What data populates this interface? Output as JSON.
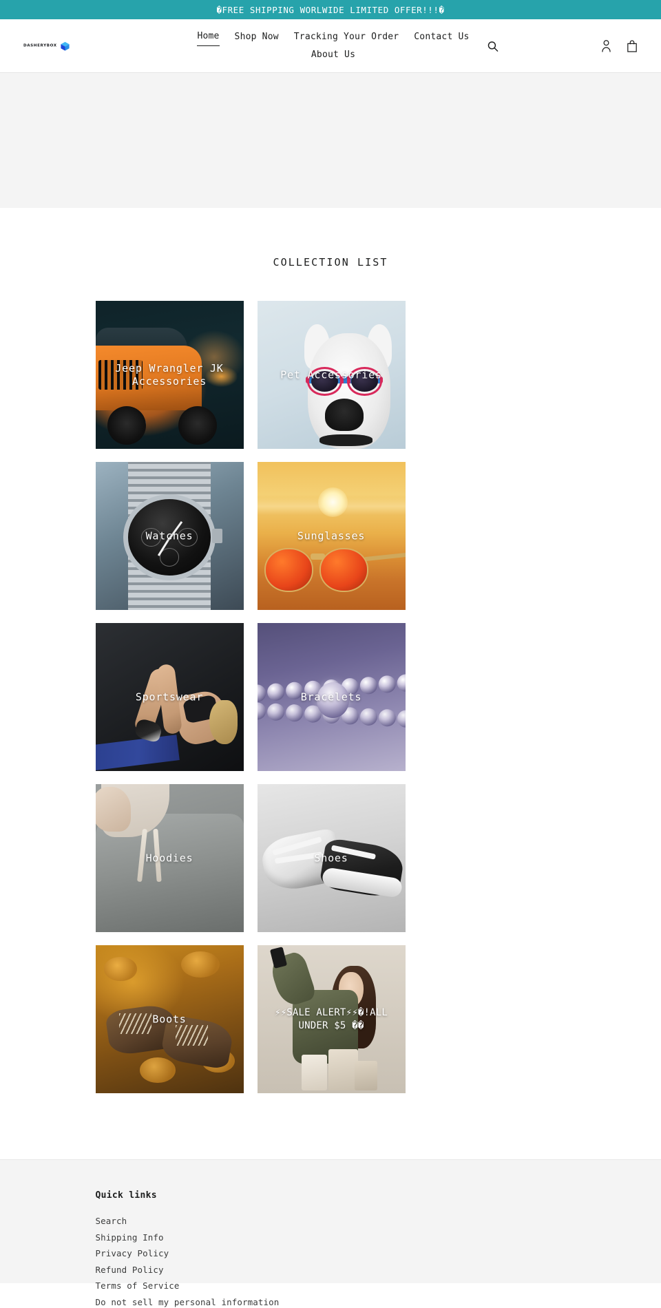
{
  "announcement": {
    "text": "�FREE SHIPPING WORLWIDE LIMITED OFFER!!!�",
    "background": "#27a3ab"
  },
  "header": {
    "logo_text": "DASHERYBOX",
    "nav": [
      {
        "label": "Home",
        "active": true
      },
      {
        "label": "Shop Now",
        "active": false
      },
      {
        "label": "Tracking Your Order",
        "active": false
      },
      {
        "label": "Contact Us",
        "active": false
      },
      {
        "label": "About Us",
        "active": false
      }
    ],
    "search_icon": "search-icon",
    "account_icon": "account-icon",
    "cart_icon": "cart-icon"
  },
  "main": {
    "section_title": "COLLECTION LIST",
    "collections": [
      {
        "title": "Jeep Wrangler JK Accessories",
        "art": "jeep"
      },
      {
        "title": "Pet Accessories",
        "art": "pet"
      },
      {
        "title": "Watches",
        "art": "watch"
      },
      {
        "title": "Sunglasses",
        "art": "sun"
      },
      {
        "title": "Sportswear",
        "art": "sport"
      },
      {
        "title": "Bracelets",
        "art": "brace"
      },
      {
        "title": "Hoodies",
        "art": "hood"
      },
      {
        "title": "Shoes",
        "art": "shoe"
      },
      {
        "title": "Boots",
        "art": "boot"
      },
      {
        "title": "⚡⚡SALE ALERT⚡⚡�!ALL UNDER $5 ��",
        "art": "sale"
      }
    ]
  },
  "footer": {
    "title": "Quick links",
    "links": [
      "Search",
      "Shipping Info",
      "Privacy Policy",
      "Refund Policy",
      "Terms of Service",
      "Do not sell my personal information"
    ]
  }
}
